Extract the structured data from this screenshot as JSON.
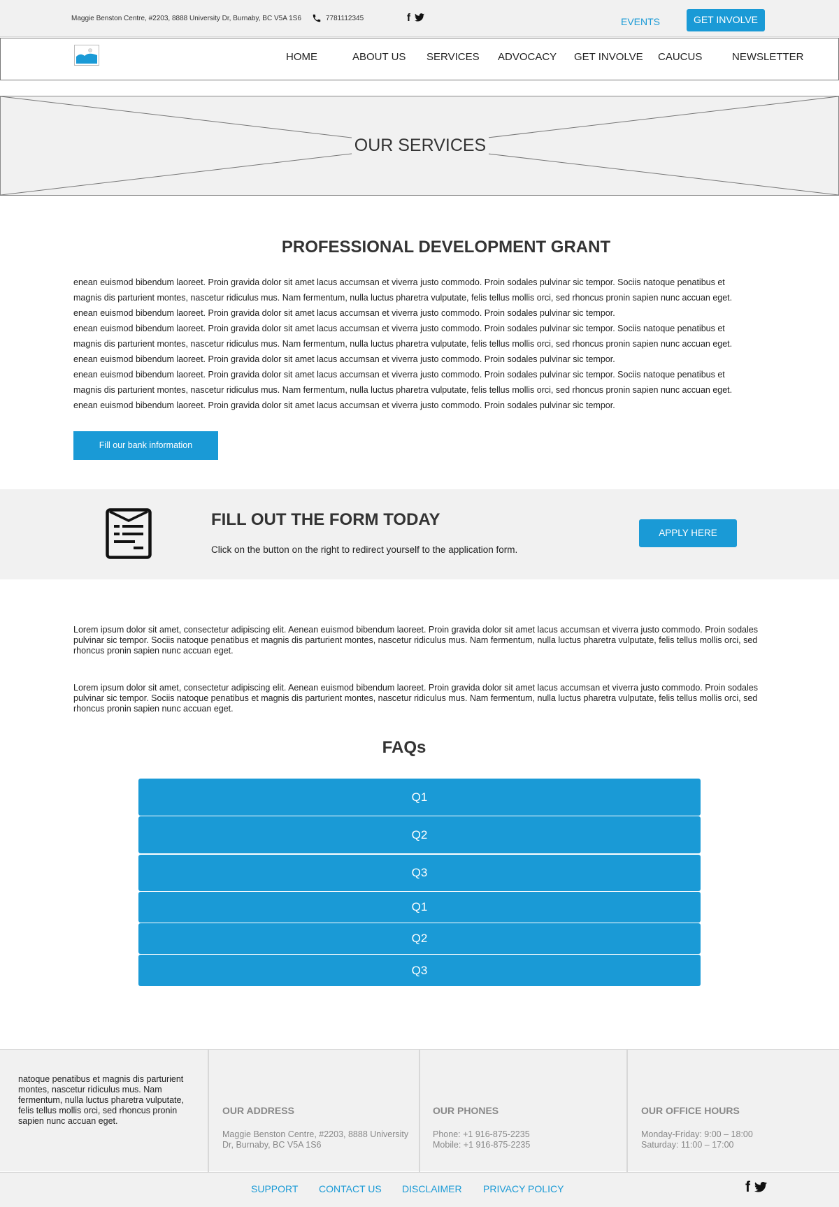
{
  "topbar": {
    "address": "Maggie Benston Centre, #2203, 8888 University Dr, Burnaby, BC V5A 1S6",
    "phone": "7781112345",
    "facebook": "f",
    "twitter": "🐦",
    "events": "EVENTS",
    "get_involve": "GET INVOLVE"
  },
  "nav": {
    "items": [
      "HOME",
      "ABOUT US",
      "SERVICES",
      "ADVOCACY",
      "GET INVOLVE",
      "CAUCUS",
      "NEWSLETTER"
    ]
  },
  "hero": {
    "title": "OUR SERVICES"
  },
  "grant": {
    "title": "PROFESSIONAL DEVELOPMENT GRANT",
    "lines": [
      "enean euismod bibendum laoreet. Proin gravida dolor sit amet lacus accumsan et viverra justo commodo. Proin sodales pulvinar sic tempor. Sociis natoque penatibus et",
      "magnis dis parturient montes, nascetur ridiculus mus. Nam fermentum, nulla luctus pharetra vulputate, felis tellus mollis orci, sed rhoncus pronin sapien nunc accuan eget.",
      "enean euismod bibendum laoreet. Proin gravida dolor sit amet lacus accumsan et viverra justo commodo. Proin sodales pulvinar sic tempor.",
      "enean euismod bibendum laoreet. Proin gravida dolor sit amet lacus accumsan et viverra justo commodo. Proin sodales pulvinar sic tempor. Sociis natoque penatibus et",
      "magnis dis parturient montes, nascetur ridiculus mus. Nam fermentum, nulla luctus pharetra vulputate, felis tellus mollis orci, sed rhoncus pronin sapien nunc accuan eget.",
      "enean euismod bibendum laoreet. Proin gravida dolor sit amet lacus accumsan et viverra justo commodo. Proin sodales pulvinar sic tempor.",
      "enean euismod bibendum laoreet. Proin gravida dolor sit amet lacus accumsan et viverra justo commodo. Proin sodales pulvinar sic tempor. Sociis natoque penatibus et",
      "magnis dis parturient montes, nascetur ridiculus mus. Nam fermentum, nulla luctus pharetra vulputate, felis tellus mollis orci, sed rhoncus pronin sapien nunc accuan eget.",
      "enean euismod bibendum laoreet. Proin gravida dolor sit amet lacus accumsan et viverra justo commodo. Proin sodales pulvinar sic tempor."
    ],
    "bank_button": "Fill our bank information"
  },
  "form_band": {
    "title": "FILL OUT THE FORM TODAY",
    "description": "Click on the button on the right to redirect yourself to the application form.",
    "apply_button": "APPLY HERE"
  },
  "paragraphs": [
    "Lorem ipsum dolor sit amet, consectetur adipiscing elit. Aenean euismod bibendum laoreet. Proin gravida dolor sit amet lacus accumsan et viverra justo commodo. Proin sodales pulvinar sic tempor. Sociis natoque penatibus et magnis dis parturient montes, nascetur ridiculus mus. Nam fermentum, nulla luctus pharetra vulputate, felis tellus mollis orci, sed rhoncus pronin sapien nunc accuan eget.",
    "Lorem ipsum dolor sit amet, consectetur adipiscing elit. Aenean euismod bibendum laoreet. Proin gravida dolor sit amet lacus accumsan et viverra justo commodo. Proin sodales pulvinar sic tempor. Sociis natoque penatibus et magnis dis parturient montes, nascetur ridiculus mus. Nam fermentum, nulla luctus pharetra vulputate, felis tellus mollis orci, sed rhoncus pronin sapien nunc accuan eget."
  ],
  "faq": {
    "title": "FAQs",
    "items": [
      "Q1",
      "Q2",
      "Q3",
      "Q1",
      "Q2",
      "Q3"
    ]
  },
  "footer": {
    "intro": "natoque penatibus et magnis dis parturient montes, nascetur ridiculus mus. Nam fermentum, nulla luctus pharetra vulputate, felis tellus mollis orci, sed rhoncus pronin sapien nunc accuan eget.",
    "address_heading": "OUR ADDRESS",
    "address_line1": "Maggie Benston Centre, #2203, 8888 University",
    "address_line2": "Dr, Burnaby, BC V5A 1S6",
    "phones_heading": "OUR PHONES",
    "phone_line": "Phone: +1 916-875-2235",
    "mobile_line": "Mobile: +1 916-875-2235",
    "hours_heading": "OUR OFFICE HOURS",
    "hours_weekday": "Monday-Friday: 9:00 – 18:00",
    "hours_saturday": "Saturday: 11:00 – 17:00"
  },
  "bottombar": {
    "links": [
      "SUPPORT",
      "CONTACT US",
      "DISCLAIMER",
      "PRIVACY POLICY"
    ],
    "facebook": "f",
    "twitter": "🐦"
  },
  "colors": {
    "accent": "#1a9ad6",
    "panel": "#f1f1f1",
    "heading": "#333333",
    "muted": "#888888"
  }
}
